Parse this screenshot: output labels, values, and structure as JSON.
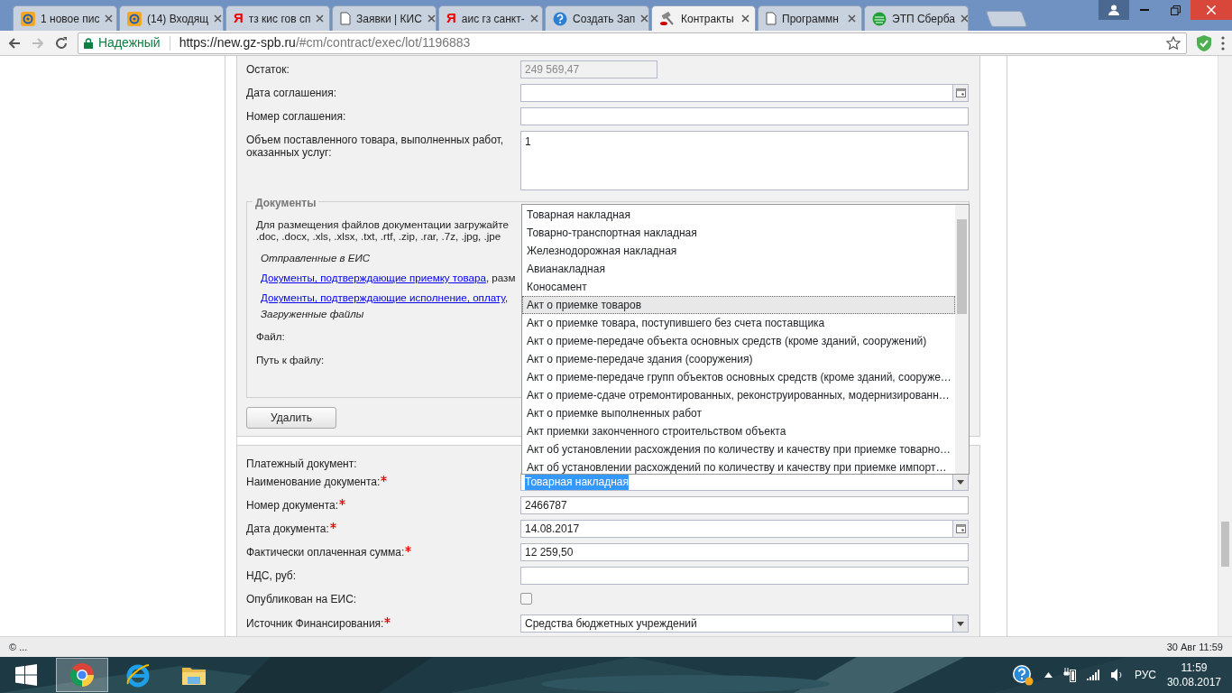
{
  "browser": {
    "tabs": [
      {
        "label": "1 новое пис",
        "kind": "mail",
        "selected": false
      },
      {
        "label": "(14) Входящ",
        "kind": "mail",
        "selected": false
      },
      {
        "label": "тз кис гов сп",
        "kind": "yandex",
        "glyph": "Я",
        "selected": false
      },
      {
        "label": "Заявки | КИС",
        "kind": "doc",
        "selected": false
      },
      {
        "label": "аис гз санкт-",
        "kind": "yandex",
        "glyph": "Я",
        "selected": false
      },
      {
        "label": "Создать Зап",
        "kind": "help",
        "selected": false
      },
      {
        "label": "Контракты",
        "kind": "gavel",
        "selected": true
      },
      {
        "label": "Программн",
        "kind": "doc",
        "selected": false
      },
      {
        "label": "ЭТП Сберба",
        "kind": "sber",
        "selected": false
      }
    ],
    "security": "Надежный",
    "url_host": "https://new.gz-spb.ru",
    "url_path": "/#cm/contract/exec/lot/1196883"
  },
  "form_top": [
    {
      "kind": "text",
      "label": "Остаток:",
      "value": "249 569,47",
      "disabled": true
    },
    {
      "kind": "date",
      "label": "Дата соглашения:"
    },
    {
      "kind": "text",
      "label": "Номер соглашения:"
    },
    {
      "kind": "textarea",
      "label": "Объем поставленного товара, выполненных работ, оказанных услуг:",
      "value": "1"
    }
  ],
  "documents": {
    "legend": "Документы",
    "hint_lines": [
      "Для размещения файлов документации загружайте",
      ".doc, .docx, .xls, .xlsx, .txt, .rtf, .zip, .rar, .7z, .jpg, .jpe"
    ],
    "sent_heading": "Отправленные в ЕИС",
    "links": [
      {
        "link": "Документы, подтверждающие приемку товара",
        "rest": ", разм"
      },
      {
        "link": "Документы, подтверждающие исполнение, оплату",
        "rest": ","
      }
    ],
    "uploaded_heading": "Загруженные файлы",
    "file_label": "Файл:",
    "path_label": "Путь к файлу:"
  },
  "delete_button": "Удалить",
  "form_bottom": [
    {
      "kind": "label",
      "label": "Платежный документ:"
    },
    {
      "kind": "select",
      "label": "Наименование документа:",
      "required": true,
      "value": "Товарная накладная",
      "focused": true
    },
    {
      "kind": "text",
      "label": "Номер документа:",
      "required": true,
      "value": "2466787"
    },
    {
      "kind": "date",
      "label": "Дата документа:",
      "required": true,
      "value": "14.08.2017"
    },
    {
      "kind": "text",
      "label": "Фактически оплаченная сумма:",
      "required": true,
      "value": "12 259,50"
    },
    {
      "kind": "text",
      "label": "НДС, руб:"
    },
    {
      "kind": "checkbox",
      "label": "Опубликован на ЕИС:",
      "checked": false
    },
    {
      "kind": "select",
      "label": "Источник Финансирования:",
      "required": true,
      "value": "Средства бюджетных учреждений"
    }
  ],
  "dropdown": {
    "items": [
      {
        "label": "Товарная накладная",
        "selected": false
      },
      {
        "label": "Товарно-транспортная накладная",
        "selected": false
      },
      {
        "label": "Железнодорожная накладная",
        "selected": false
      },
      {
        "label": "Авианакладная",
        "selected": false
      },
      {
        "label": "Коносамент",
        "selected": false
      },
      {
        "label": "Акт о приемке товаров",
        "selected": true
      },
      {
        "label": "Акт о приемке товара, поступившего без счета поставщика",
        "selected": false
      },
      {
        "label": "Акт о приеме-передаче объекта основных средств (кроме зданий, сооружений)",
        "selected": false
      },
      {
        "label": "Акт о приеме-передаче здания (сооружения)",
        "selected": false
      },
      {
        "label": "Акт о приеме-передаче групп объектов основных средств (кроме зданий, сооруже…",
        "selected": false
      },
      {
        "label": "Акт о приеме-сдаче отремонтированных, реконструированных, модернизированн…",
        "selected": false
      },
      {
        "label": "Акт о приемке выполненных работ",
        "selected": false
      },
      {
        "label": "Акт приемки законченного строительством объекта",
        "selected": false
      },
      {
        "label": "Акт об установлении расхождения по количеству и качеству при приемке товарно…",
        "selected": false
      },
      {
        "label": "Акт об установлении расхождений по количеству и качеству при приемке импорт…",
        "selected": false
      }
    ]
  },
  "status_bar": {
    "left": "© ...",
    "right": "30 Авг 11:59"
  },
  "taskbar": {
    "apps": [
      {
        "kind": "chrome",
        "selected": true
      },
      {
        "kind": "ie",
        "selected": false
      },
      {
        "kind": "explorer",
        "selected": false
      }
    ],
    "language": "РУС",
    "time": "11:59",
    "date": "30.08.2017"
  }
}
